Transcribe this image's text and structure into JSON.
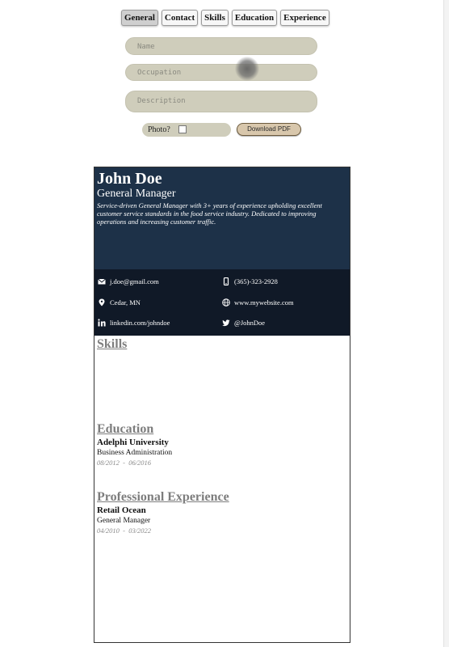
{
  "tabs": [
    "General",
    "Contact",
    "Skills",
    "Education",
    "Experience"
  ],
  "form": {
    "name_placeholder": "Name",
    "occupation_placeholder": "Occupation",
    "description_placeholder": "Description",
    "photo_label": "Photo?",
    "download_label": "Download PDF"
  },
  "resume": {
    "name": "John Doe",
    "occupation": "General Manager",
    "description": "Service-driven General Manager with 3+ years of experience upholding excellent customer service standards in the food service industry. Dedicated to improving operations and increasing customer traffic.",
    "contact": {
      "email": "j.doe@gmail.com",
      "phone": "(365)-323-2928",
      "location": "Cedar, MN",
      "website": "www.mywebsite.com",
      "linkedin": "linkedin.com/johndoe",
      "twitter": "@JohnDoe"
    },
    "skills_title": "Skills",
    "education_title": "Education",
    "education": {
      "school": "Adelphi University",
      "degree": "Business Administration",
      "dates": "08/2012  -  06/2016"
    },
    "experience_title": "Professional Experience",
    "experience": {
      "company": "Retail Ocean",
      "title": "General Manager",
      "dates": "04/2010  -  03/2022"
    }
  },
  "colors": {
    "header_bg": "#1d3148",
    "contact_bg": "#101927",
    "input_bg": "#cfcdbb",
    "section_title": "#7d7d7d"
  },
  "icons": [
    "mail-icon",
    "phone-icon",
    "location-pin-icon",
    "globe-icon",
    "linkedin-icon",
    "twitter-icon"
  ]
}
